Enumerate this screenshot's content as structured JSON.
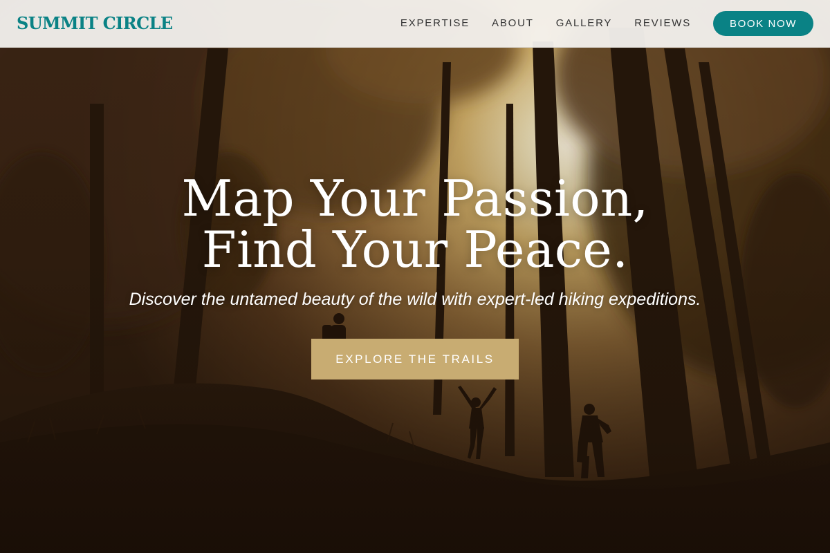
{
  "brand": {
    "name": "SUMMIT CIRCLE",
    "accent": "#0a8285"
  },
  "nav": {
    "links": [
      "EXPERTISE",
      "ABOUT",
      "GALLERY",
      "REVIEWS"
    ],
    "cta": "BOOK NOW"
  },
  "hero": {
    "title_line1": "Map Your Passion,",
    "title_line2": "Find Your Peace.",
    "subtitle": "Discover the untamed beauty of the wild with expert-led hiking expeditions.",
    "cta": "EXPLORE THE TRAILS",
    "cta_color": "#c8ac72"
  }
}
